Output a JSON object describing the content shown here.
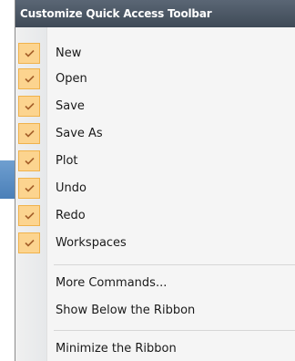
{
  "menu": {
    "title": "Customize Quick Access Toolbar",
    "checked_items": [
      {
        "label": "New",
        "checked": true
      },
      {
        "label": "Open",
        "checked": true
      },
      {
        "label": "Save",
        "checked": true
      },
      {
        "label": "Save As",
        "checked": true
      },
      {
        "label": "Plot",
        "checked": true
      },
      {
        "label": "Undo",
        "checked": true
      },
      {
        "label": "Redo",
        "checked": true
      },
      {
        "label": "Workspaces",
        "checked": true
      }
    ],
    "more_commands": "More Commands...",
    "show_below": "Show Below the Ribbon",
    "minimize": "Minimize the Ribbon"
  },
  "colors": {
    "title_bg": "#4a5562",
    "check_bg": "#fcd48f",
    "check_border": "#f0b24b",
    "check_mark": "#a5602a"
  },
  "icons": {
    "check": "checkmark-icon"
  }
}
